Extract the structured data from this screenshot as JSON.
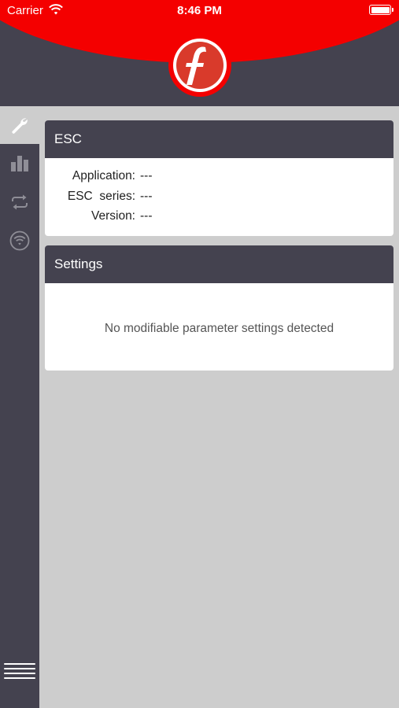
{
  "status_bar": {
    "carrier": "Carrier",
    "time": "8:46 PM"
  },
  "colors": {
    "header_red": "#f40000",
    "dark_panel": "#44424f",
    "background": "#cdcdcd"
  },
  "sidebar": {
    "items": [
      {
        "icon": "wrench-icon",
        "active": true
      },
      {
        "icon": "bar-chart-icon",
        "active": false
      },
      {
        "icon": "sync-icon",
        "active": false
      },
      {
        "icon": "wifi-icon",
        "active": false
      }
    ],
    "menu_icon": "hamburger-menu-icon"
  },
  "esc_card": {
    "title": "ESC",
    "rows": [
      {
        "label": "Application:",
        "value": "---"
      },
      {
        "label": "ESC  series:",
        "value": "---"
      },
      {
        "label": "Version:",
        "value": "---"
      }
    ]
  },
  "settings_card": {
    "title": "Settings",
    "message": "No modifiable parameter settings detected"
  }
}
